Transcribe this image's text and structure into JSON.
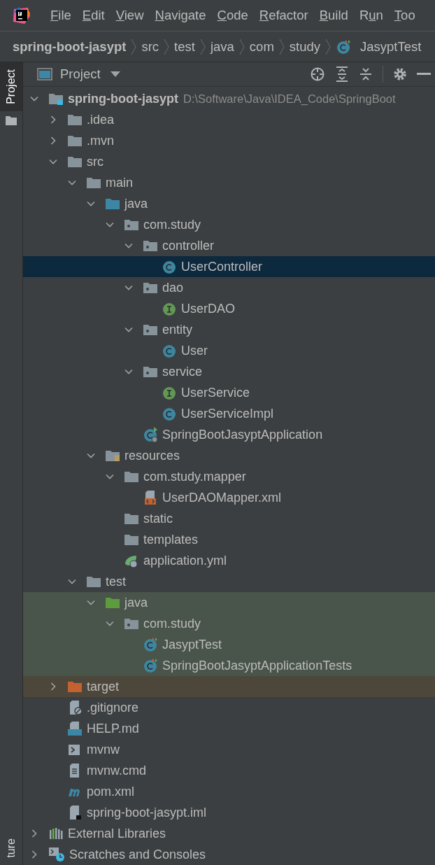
{
  "menu": [
    {
      "key": "F",
      "rest": "ile"
    },
    {
      "key": "E",
      "rest": "dit"
    },
    {
      "key": "V",
      "rest": "iew"
    },
    {
      "key": "N",
      "rest": "avigate"
    },
    {
      "key": "C",
      "rest": "ode"
    },
    {
      "key": "R",
      "rest": "efactor"
    },
    {
      "key": "B",
      "rest": "uild"
    },
    {
      "lead": "R",
      "key": "u",
      "rest": "n"
    },
    {
      "key": "T",
      "rest": "oo"
    }
  ],
  "breadcrumbs": [
    {
      "label": "spring-boot-jasypt",
      "kind": "project"
    },
    {
      "label": "src",
      "kind": "dir"
    },
    {
      "label": "test",
      "kind": "dir"
    },
    {
      "label": "java",
      "kind": "dir"
    },
    {
      "label": "com",
      "kind": "dir"
    },
    {
      "label": "study",
      "kind": "dir"
    },
    {
      "label": "JasyptTest",
      "kind": "test-class"
    }
  ],
  "side_tabs": [
    {
      "label": "Project",
      "selected": true,
      "kind": "tab"
    },
    {
      "label": "ture",
      "selected": false,
      "kind": "bottom"
    }
  ],
  "panel": {
    "title": "Project"
  },
  "tree": [
    {
      "name": "spring-boot-jasypt",
      "kind": "module",
      "hint": "D:\\Software\\Java\\IDEA_Code\\SpringBoot",
      "expanded": true,
      "children": [
        {
          "name": ".idea",
          "kind": "folder",
          "expanded": false
        },
        {
          "name": ".mvn",
          "kind": "folder",
          "expanded": false
        },
        {
          "name": "src",
          "kind": "folder",
          "expanded": true,
          "children": [
            {
              "name": "main",
              "kind": "folder",
              "expanded": true,
              "children": [
                {
                  "name": "java",
                  "kind": "source",
                  "expanded": true,
                  "children": [
                    {
                      "name": "com.study",
                      "kind": "package",
                      "expanded": true,
                      "children": [
                        {
                          "name": "controller",
                          "kind": "package",
                          "expanded": true,
                          "children": [
                            {
                              "name": "UserController",
                              "kind": "class",
                              "selected": true
                            }
                          ]
                        },
                        {
                          "name": "dao",
                          "kind": "package",
                          "expanded": true,
                          "children": [
                            {
                              "name": "UserDAO",
                              "kind": "interface",
                              "selected": false
                            }
                          ]
                        },
                        {
                          "name": "entity",
                          "kind": "package",
                          "expanded": true,
                          "children": [
                            {
                              "name": "User",
                              "kind": "class",
                              "selected": false
                            }
                          ]
                        },
                        {
                          "name": "service",
                          "kind": "package",
                          "expanded": true,
                          "children": [
                            {
                              "name": "UserService",
                              "kind": "interface",
                              "selected": false
                            },
                            {
                              "name": "UserServiceImpl",
                              "kind": "class",
                              "selected": false
                            }
                          ]
                        },
                        {
                          "name": "SpringBootJasyptApplication",
                          "kind": "application",
                          "selected": false
                        }
                      ]
                    }
                  ]
                },
                {
                  "name": "resources",
                  "kind": "resources",
                  "expanded": true,
                  "children": [
                    {
                      "name": "com.study.mapper",
                      "kind": "folder",
                      "expanded": true,
                      "children": [
                        {
                          "name": "UserDAOMapper.xml",
                          "kind": "xml",
                          "selected": false
                        }
                      ]
                    },
                    {
                      "name": "static",
                      "kind": "folder"
                    },
                    {
                      "name": "templates",
                      "kind": "folder"
                    },
                    {
                      "name": "application.yml",
                      "kind": "config",
                      "selected": false
                    }
                  ]
                }
              ]
            },
            {
              "name": "test",
              "kind": "folder",
              "expanded": true,
              "children": [
                {
                  "name": "java",
                  "kind": "tests",
                  "color": "#49544a",
                  "expanded": true,
                  "children": [
                    {
                      "name": "com.study",
                      "kind": "package",
                      "color": "#49544a",
                      "expanded": true,
                      "children": [
                        {
                          "name": "JasyptTest",
                          "kind": "test",
                          "color": "#49544a",
                          "selected": false
                        },
                        {
                          "name": "SpringBootJasyptApplicationTests",
                          "kind": "test",
                          "color": "#49544a",
                          "selected": false
                        }
                      ]
                    }
                  ]
                }
              ]
            }
          ]
        },
        {
          "name": "target",
          "kind": "excluded",
          "color": "#4d473b",
          "expanded": false
        },
        {
          "name": ".gitignore",
          "kind": "ignore",
          "selected": false
        },
        {
          "name": "HELP.md",
          "kind": "markdown",
          "selected": false
        },
        {
          "name": "mvnw",
          "kind": "shell",
          "selected": false
        },
        {
          "name": "mvnw.cmd",
          "kind": "text",
          "selected": false
        },
        {
          "name": "pom.xml",
          "kind": "maven",
          "selected": false
        },
        {
          "name": "spring-boot-jasypt.iml",
          "kind": "iml",
          "selected": false
        }
      ]
    },
    {
      "name": "External Libraries",
      "kind": "libraries",
      "expanded": false
    },
    {
      "name": "Scratches and Consoles",
      "kind": "scratches",
      "expanded": false
    }
  ]
}
